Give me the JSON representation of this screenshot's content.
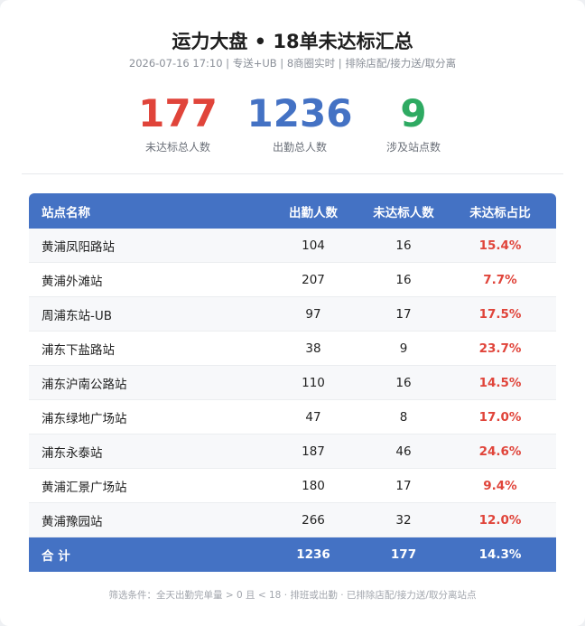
{
  "header": {
    "title": "运力大盘 • 18单未达标汇总",
    "subtitle": "2026-07-16 17:10 | 专送+UB | 8商圈实时 | 排除店配/接力送/取分离"
  },
  "stats": [
    {
      "value": "177",
      "label": "未达标总人数",
      "color": "#e0443a"
    },
    {
      "value": "1236",
      "label": "出勤总人数",
      "color": "#4472c4"
    },
    {
      "value": "9",
      "label": "涉及站点数",
      "color": "#2eaa62"
    }
  ],
  "table": {
    "headers": [
      "站点名称",
      "出勤人数",
      "未达标人数",
      "未达标占比"
    ],
    "rows": [
      {
        "name": "黄浦凤阳路站",
        "attend": "104",
        "fail": "16",
        "pct": "15.4%"
      },
      {
        "name": "黄浦外滩站",
        "attend": "207",
        "fail": "16",
        "pct": "7.7%"
      },
      {
        "name": "周浦东站-UB",
        "attend": "97",
        "fail": "17",
        "pct": "17.5%"
      },
      {
        "name": "浦东下盐路站",
        "attend": "38",
        "fail": "9",
        "pct": "23.7%"
      },
      {
        "name": "浦东沪南公路站",
        "attend": "110",
        "fail": "16",
        "pct": "14.5%"
      },
      {
        "name": "浦东绿地广场站",
        "attend": "47",
        "fail": "8",
        "pct": "17.0%"
      },
      {
        "name": "浦东永泰站",
        "attend": "187",
        "fail": "46",
        "pct": "24.6%"
      },
      {
        "name": "黄浦汇景广场站",
        "attend": "180",
        "fail": "17",
        "pct": "9.4%"
      },
      {
        "name": "黄浦豫园站",
        "attend": "266",
        "fail": "32",
        "pct": "12.0%"
      }
    ],
    "total": {
      "name": "合 计",
      "attend": "1236",
      "fail": "177",
      "pct": "14.3%"
    }
  },
  "footer_note": "筛选条件：全天出勤完单量 > 0 且 < 18 · 排班或出勤 · 已排除店配/接力送/取分离站点"
}
